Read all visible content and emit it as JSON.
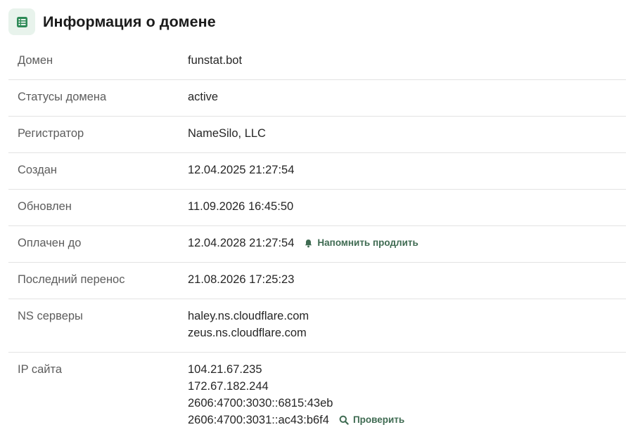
{
  "header": {
    "title": "Информация о домене",
    "icon": "table-icon"
  },
  "rows": [
    {
      "label": "Домен",
      "values": [
        "funstat.bot"
      ]
    },
    {
      "label": "Статусы домена",
      "values": [
        "active"
      ]
    },
    {
      "label": "Регистратор",
      "values": [
        "NameSilo, LLC"
      ]
    },
    {
      "label": "Создан",
      "values": [
        "12.04.2025 21:27:54"
      ]
    },
    {
      "label": "Обновлен",
      "values": [
        "11.09.2026 16:45:50"
      ]
    },
    {
      "label": "Оплачен до",
      "values": [
        "12.04.2028 21:27:54"
      ],
      "action": {
        "label": "Напомнить продлить",
        "icon": "bell-icon"
      }
    },
    {
      "label": "Последний перенос",
      "values": [
        "21.08.2026 17:25:23"
      ]
    },
    {
      "label": "NS серверы",
      "values": [
        "haley.ns.cloudflare.com",
        "zeus.ns.cloudflare.com"
      ]
    },
    {
      "label": "IP сайта",
      "values": [
        "104.21.67.235",
        "172.67.182.244",
        "2606:4700:3030::6815:43eb",
        "2606:4700:3031::ac43:b6f4"
      ],
      "action": {
        "label": "Проверить",
        "icon": "search-icon"
      }
    }
  ],
  "colors": {
    "accent": "#3f6b52",
    "icon_bg": "#e8f3ec",
    "icon_fg": "#2e8a57"
  }
}
